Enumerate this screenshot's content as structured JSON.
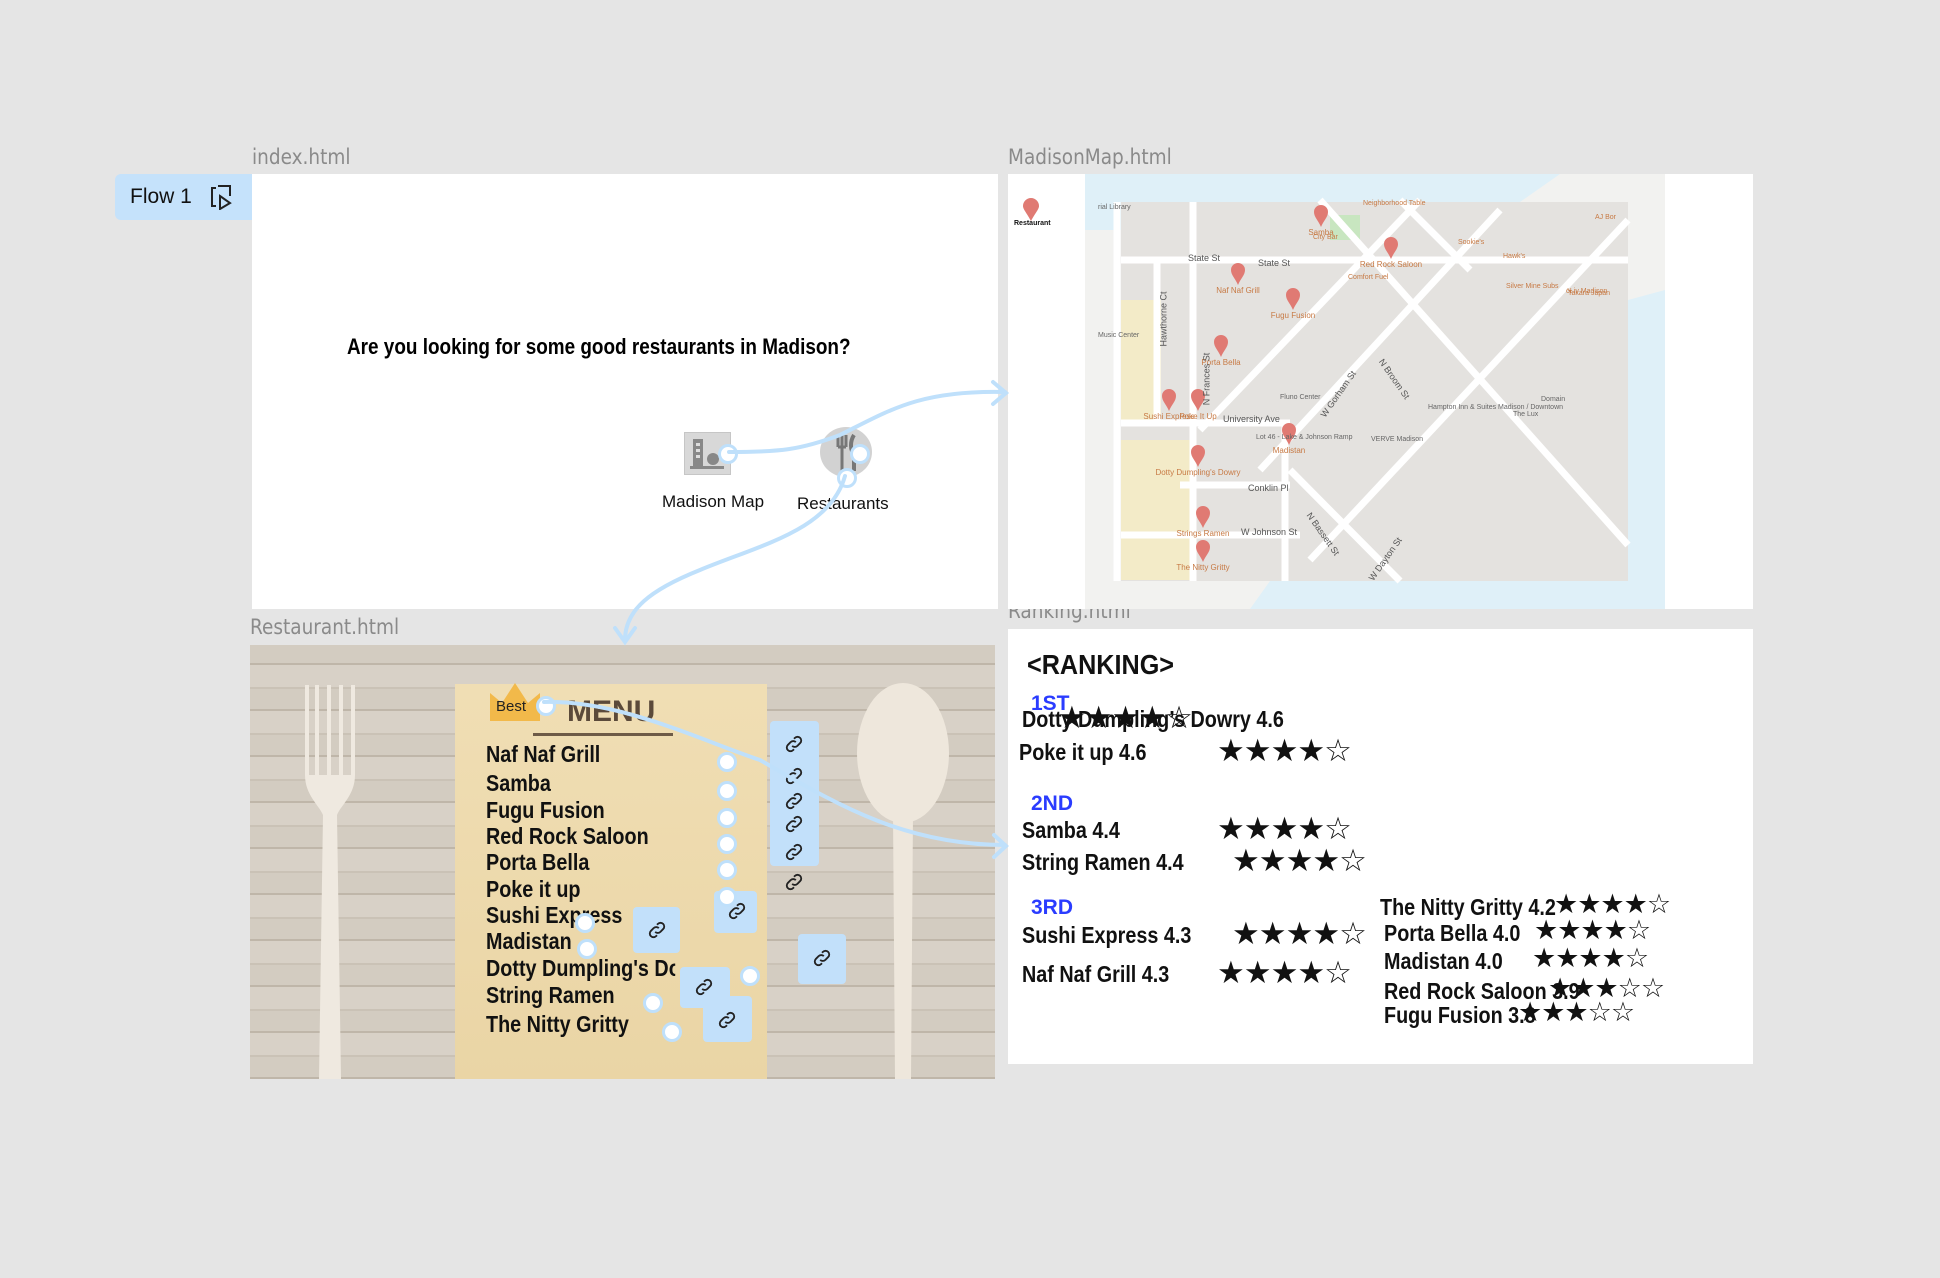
{
  "flow": {
    "label": "Flow 1",
    "icon": "play-frame-icon"
  },
  "frames": {
    "index": "index.html",
    "map": "MadisonMap.html",
    "restaurant": "Restaurant.html",
    "ranking": "Ranking.html"
  },
  "index": {
    "question": "Are you looking for some good restaurants in Madison?",
    "buttons": [
      {
        "label": "Madison Map",
        "icon": "building-map-icon"
      },
      {
        "label": "Restaurants",
        "icon": "fork-knife-icon"
      }
    ]
  },
  "map": {
    "legend_label": "Restaurant",
    "pins": [
      "Samba",
      "Red Rock Saloon",
      "Naf Naf Grill",
      "Fugu Fusion",
      "Porta Bella",
      "Sushi Express",
      "Poke It Up",
      "Madistan",
      "Dotty Dumpling's Dowry",
      "Strings Ramen",
      "The Nitty Gritty"
    ],
    "places": [
      "Neighborhood Table",
      "City Bar",
      "Sookie's",
      "Hawk's",
      "Comfort Fuel",
      "Silver Mine Subs",
      "Takara Japan",
      "AJ Bor",
      "öLiv Madison",
      "Music Center",
      "Fluno Center",
      "Hampton Inn & Suites Madison / Downtown",
      "Domain",
      "The Lux",
      "VERVE Madison",
      "Lot 46 - Lake & Johnson Ramp",
      "rial Library"
    ],
    "streets": [
      "State St",
      "State St",
      "University Ave",
      "W Johnson St",
      "Conklin Pl",
      "W Gorham St",
      "N Broom St",
      "N Bassett St",
      "W Dayton St",
      "Hawthorne Ct",
      "N Frances St"
    ]
  },
  "restaurant": {
    "badge": "Best",
    "menu_title": "MENU",
    "items": [
      "Naf Naf Grill",
      "Samba",
      "Fugu Fusion",
      "Red Rock Saloon",
      "Porta Bella",
      "Poke it up",
      "Sushi Express",
      "Madistan",
      "Dotty Dumpling's Dowry",
      "String Ramen",
      "The Nitty Gritty"
    ]
  },
  "ranking": {
    "title": "<RANKING>",
    "sections": [
      {
        "label": "1ST",
        "entries": [
          {
            "name": "Dotty Dumpling’s Dowry 4.6",
            "stars": 4
          },
          {
            "name": "Poke it up 4.6",
            "stars": 4
          }
        ]
      },
      {
        "label": "2ND",
        "entries": [
          {
            "name": "Samba 4.4",
            "stars": 4
          },
          {
            "name": "String Ramen 4.4",
            "stars": 4
          }
        ]
      },
      {
        "label": "3RD",
        "entries": [
          {
            "name": "Sushi Express 4.3",
            "stars": 4
          },
          {
            "name": "Naf Naf Grill 4.3",
            "stars": 4
          },
          {
            "name": "The Nitty Gritty 4.2",
            "stars": 4
          },
          {
            "name": "Porta Bella 4.0",
            "stars": 4
          },
          {
            "name": "Madistan 4.0",
            "stars": 4
          },
          {
            "name": "Red Rock Saloon 3.9",
            "stars": 3
          },
          {
            "name": "Fugu Fusion 3.8",
            "stars": 3
          }
        ]
      }
    ],
    "stars_total": 5
  },
  "colors": {
    "accent": "#c5e2fb",
    "section": "#2a3cff",
    "pin": "#e07a73"
  }
}
